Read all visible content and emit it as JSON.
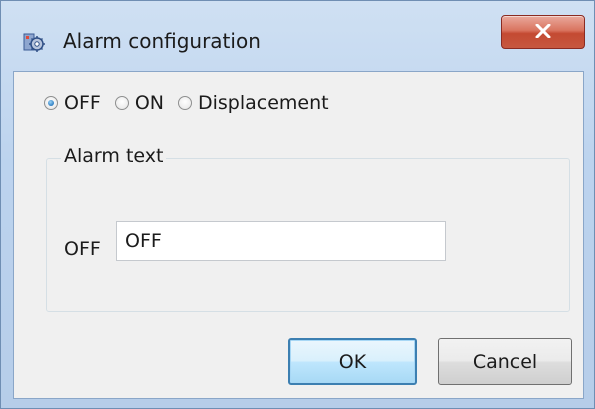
{
  "window": {
    "title": "Alarm configuration",
    "close_label": "x"
  },
  "mode": {
    "options": [
      "OFF",
      "ON",
      "Displacement"
    ],
    "selected": "OFF"
  },
  "alarm_text": {
    "group_label": "Alarm text",
    "field_label": "OFF",
    "field_value": "OFF"
  },
  "buttons": {
    "ok": "OK",
    "cancel": "Cancel"
  },
  "colors": {
    "title_gradient": "#bcd3ee",
    "close_button": "#c44a32",
    "default_button_border": "#3c7fb1",
    "client_background": "#f0f0f0"
  },
  "icons": {
    "app": "gear-app-icon",
    "close": "close-icon"
  }
}
